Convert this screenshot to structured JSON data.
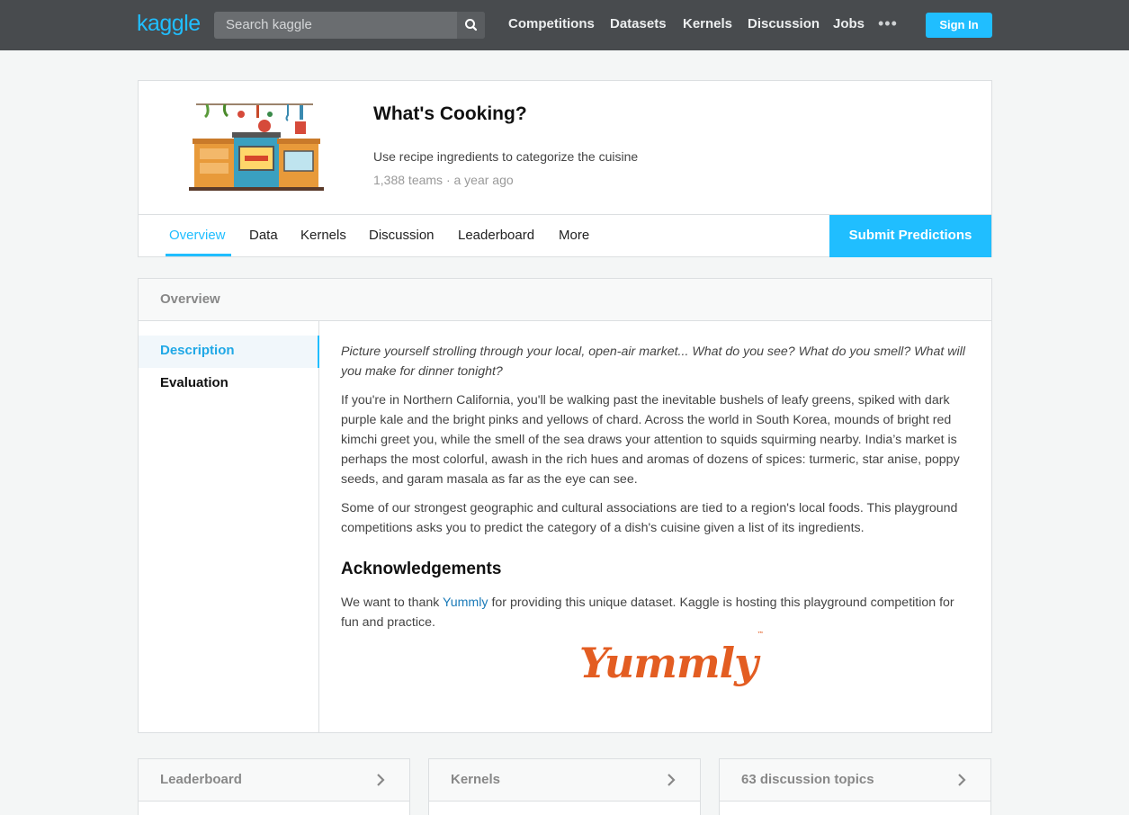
{
  "topnav": {
    "logo": "kaggle",
    "search_placeholder": "Search kaggle",
    "items": [
      "Competitions",
      "Datasets",
      "Kernels",
      "Discussion",
      "Jobs"
    ],
    "more": "•••",
    "signin": "Sign In"
  },
  "competition": {
    "title": "What's Cooking?",
    "subtitle": "Use recipe ingredients to categorize the cuisine",
    "meta": "1,388 teams · a year ago",
    "tabs": [
      "Overview",
      "Data",
      "Kernels",
      "Discussion",
      "Leaderboard",
      "More"
    ],
    "active_tab": "Overview",
    "submit_label": "Submit Predictions"
  },
  "overview": {
    "header": "Overview",
    "sidebar": [
      "Description",
      "Evaluation"
    ],
    "intro": "Picture yourself strolling through your local, open-air market... What do you see? What do you smell? What will you make for dinner tonight?",
    "para1": "If you're in Northern California, you'll be walking past the inevitable bushels of leafy greens, spiked with dark purple kale and the bright pinks and yellows of chard. Across the world in South Korea, mounds of bright red kimchi greet you, while the smell of the sea draws your attention to squids squirming nearby. India’s market is perhaps the most colorful, awash in the rich hues and aromas of dozens of spices: turmeric, star anise, poppy seeds, and garam masala as far as the eye can see.",
    "para2": "Some of our strongest geographic and cultural associations are tied to a region's local foods. This playground competitions asks you to predict the category of a dish's cuisine given a list of its ingredients.",
    "ack_heading": "Acknowledgements",
    "ack_before": "We want to thank ",
    "ack_link": "Yummly",
    "ack_after": " for providing this unique dataset. Kaggle is hosting this playground competition for fun and practice.",
    "logo_text": "Yummly",
    "logo_tm": "™"
  },
  "bottom_cards": [
    "Leaderboard",
    "Kernels",
    "63 discussion topics"
  ],
  "colors": {
    "accent": "#20beff",
    "nav_bg": "#484b4e",
    "yummly": "#e35d22"
  }
}
